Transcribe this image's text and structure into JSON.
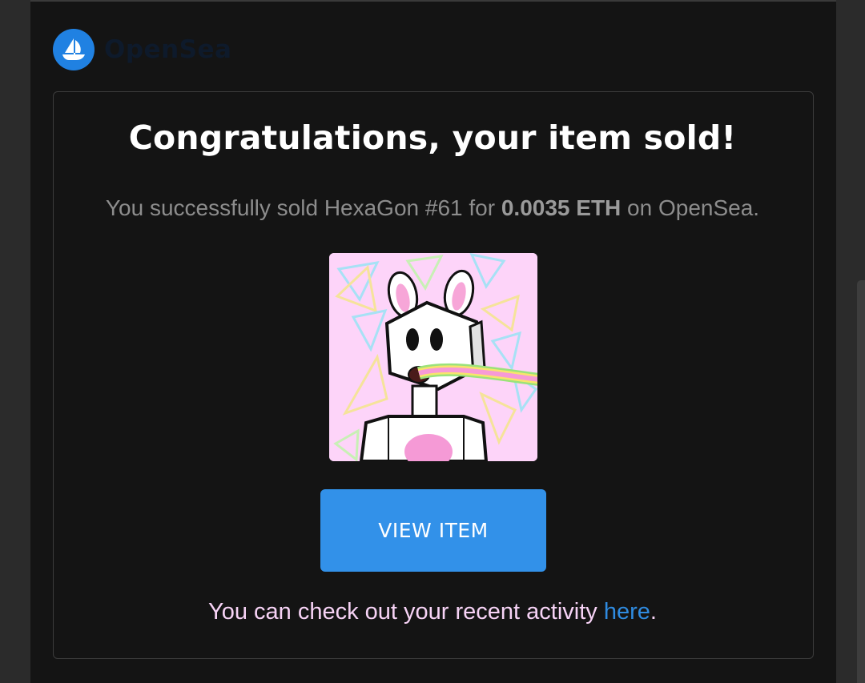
{
  "brand": {
    "logo_icon": "opensea-boat-icon",
    "name": "OpenSea",
    "accent_color": "#2081e2"
  },
  "message": {
    "title": "Congratulations, your item sold!",
    "subtitle_prefix": "You successfully sold HexaGon #61 for ",
    "price": "0.0035 ETH",
    "subtitle_suffix": " on OpenSea.",
    "item_image_alt": "HexaGon #61"
  },
  "actions": {
    "view_item_label": "VIEW ITEM",
    "button_color": "#3291e9"
  },
  "footer": {
    "activity_text": "You can check out your recent activity ",
    "link_label": "here",
    "trailing": "."
  }
}
